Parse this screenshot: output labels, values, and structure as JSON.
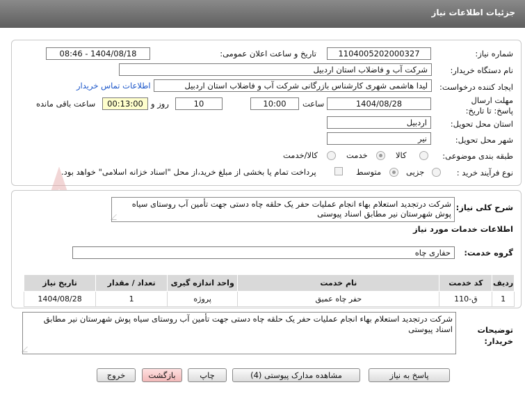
{
  "header": {
    "title": "جزئیات اطلاعات نیاز"
  },
  "form": {
    "need_number": {
      "label": "شماره نیاز:",
      "value": "1104005202000327"
    },
    "announce_datetime": {
      "label": "تاریخ و ساعت اعلان عمومی:",
      "value": "1404/08/18 - 08:46"
    },
    "buyer_org": {
      "label": "نام دستگاه خریدار:",
      "value": "شرکت آب و فاضلاب استان اردبیل"
    },
    "requester": {
      "label": "ایجاد کننده درخواست:",
      "value": "لیدا  هاشمی شهری کارشناس بازرگانی شرکت آب و فاضلاب استان اردبیل"
    },
    "buyer_contact_link": "اطلاعات تماس خریدار",
    "deadline": {
      "label": "مهلت ارسال پاسخ: تا تاریخ:",
      "date": "1404/08/28",
      "time_label": "ساعت",
      "time": "10:00",
      "days": "10",
      "days_label": "روز و",
      "remaining": "00:13:00",
      "remaining_label": "ساعت باقی مانده"
    },
    "province": {
      "label": "استان محل تحویل:",
      "value": "اردبیل"
    },
    "city": {
      "label": "شهر محل تحویل:",
      "value": "نیر"
    },
    "category": {
      "label": "طبقه بندی موضوعی:",
      "options": [
        "کالا",
        "خدمت",
        "کالا/خدمت"
      ],
      "selected": "خدمت"
    },
    "process_type": {
      "label": "نوع فرآیند خرید :",
      "options": [
        "جزیی",
        "متوسط"
      ],
      "selected": "متوسط",
      "payment_note": "پرداخت تمام یا بخشی از مبلغ خرید،از محل \"اسناد خزانه اسلامی\" خواهد بود."
    }
  },
  "description": {
    "label": "شرح کلی نیاز:",
    "value": "شرکت درتجدید استعلام بهاء انجام عملیات حفر یک حلقه چاه دستی جهت تأمین آب روستای سیاه پوش شهرستان نیر مطابق اسناد پیوستی"
  },
  "services": {
    "section_title": "اطلاعات خدمات مورد نیاز",
    "group_label": "گروه خدمت:",
    "group_value": "حفاری چاه",
    "columns": [
      "ردیف",
      "کد خدمت",
      "نام خدمت",
      "واحد اندازه گیری",
      "تعداد / مقدار",
      "تاریخ نیاز"
    ],
    "rows": [
      [
        "1",
        "ق-110",
        "حفر چاه عمیق",
        "پروژه",
        "1",
        "1404/08/28"
      ]
    ]
  },
  "buyer_notes": {
    "label": "توضیحات خریدار:",
    "value": "شرکت درتجدید استعلام بهاء انجام عملیات حفر یک حلقه چاه دستی جهت تأمین آب روستای سیاه پوش شهرستان نیر مطابق اسناد پیوستی"
  },
  "buttons": {
    "respond": "پاسخ به نیاز",
    "attachments": "مشاهده مدارک پیوستی (4)",
    "print": "چاپ",
    "back": "بازگشت",
    "exit": "خروج"
  },
  "watermark": "AriaTender.net",
  "colors": {
    "header_bg": "#6e6e6e",
    "link": "#1a55c9",
    "yellow_field": "#ffffcc",
    "table_header": "#d9d9d9"
  }
}
